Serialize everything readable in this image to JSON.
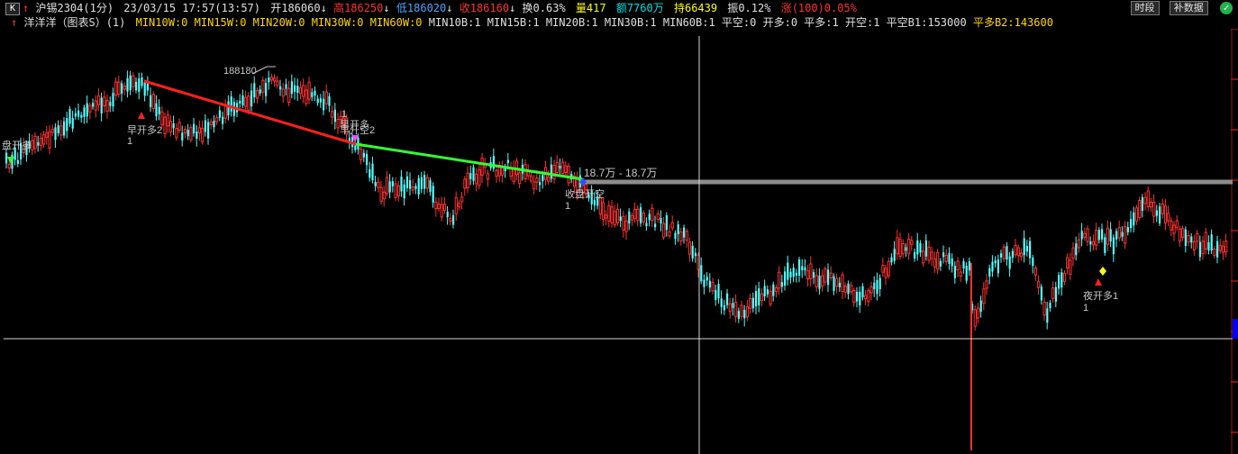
{
  "header": {
    "k_button": "K",
    "title": "沪锡2304(1分)",
    "datetime": "23/03/15 17:57(13:57)",
    "open": "开186060",
    "high": "高186250",
    "low": "低186020",
    "close": "收186160",
    "turnover": "换0.63%",
    "volume": "量417",
    "amount": "额7760万",
    "hold": "持66439",
    "amplitude": "振0.12%",
    "change": "涨(100)0.05%"
  },
  "top_buttons": {
    "period": "时段",
    "supplement": "补数据"
  },
  "indicator": {
    "name": "洋洋洋（图表S）(1)",
    "min_w": [
      "MIN10W:0",
      "MIN15W:0",
      "MIN20W:0",
      "MIN30W:0",
      "MIN60W:0"
    ],
    "min_b": [
      "MIN10B:1",
      "MIN15B:1",
      "MIN20B:1",
      "MIN30B:1",
      "MIN60B:1"
    ],
    "flags": [
      "平空:0",
      "开多:0",
      "平多:1",
      "开空:1",
      "平空B1:153000"
    ],
    "last_flag": "平多B2:143600"
  },
  "annotations": {
    "peak_value": "188180",
    "range_text": "18.7万 - 18.7万",
    "early_open_long": "早开多2",
    "night_open_long": "夜开多1",
    "close_open_short": "收盘开空",
    "left_open_long": "盘开多",
    "mid_label_1": "1",
    "mid_label_2": "早开多",
    "mid_label_3": "早开空2",
    "count_1": "1"
  },
  "colors": {
    "background": "#000000",
    "up": "#ff3232",
    "down": "#54ffff",
    "trend_down": "#ff2020",
    "trend_flat": "#33ff33",
    "level_line": "#8c8c8c"
  }
}
